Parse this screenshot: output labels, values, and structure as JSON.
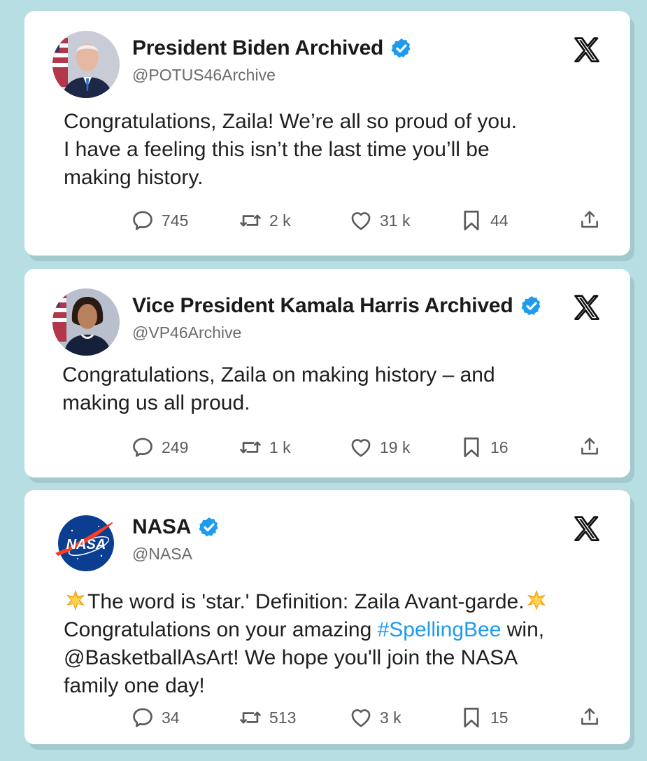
{
  "tweets": [
    {
      "name": "President Biden Archived",
      "handle": "@POTUS46Archive",
      "text_lines": [
        "Congratulations, Zaila! We’re all so proud of you.",
        "I have a feeling this isn’t the last time you’ll be",
        "making history."
      ],
      "stats": {
        "replies": "745",
        "retweets": "2 k",
        "likes": "31 k",
        "bookmarks": "44"
      }
    },
    {
      "name": "Vice President Kamala Harris Archived",
      "handle": "@VP46Archive",
      "text_lines": [
        "Congratulations, Zaila on making history – and",
        "making us all proud."
      ],
      "stats": {
        "replies": "249",
        "retweets": "1 k",
        "likes": "19 k",
        "bookmarks": "16"
      }
    },
    {
      "name": "NASA",
      "handle": "@NASA",
      "text": {
        "line1": "The word is 'star.' Definition: Zaila Avant-garde.",
        "line2_before": "Congratulations on your amazing ",
        "hashtag": "#SpellingBee",
        "line2_after": " win,",
        "line3": "@BasketballAsArt! We hope you'll join the NASA",
        "line4": "family one day!"
      },
      "avatar_text": "NASA",
      "stats": {
        "replies": "34",
        "retweets": "513",
        "likes": "3 k",
        "bookmarks": "15"
      }
    }
  ],
  "colors": {
    "background": "#b7dfe3",
    "verified": "#1d9bf0",
    "link": "#1d9bf0"
  },
  "icons": [
    "reply-icon",
    "retweet-icon",
    "like-icon",
    "bookmark-icon",
    "share-icon",
    "x-logo-icon",
    "verified-icon",
    "star-emoji-icon"
  ]
}
